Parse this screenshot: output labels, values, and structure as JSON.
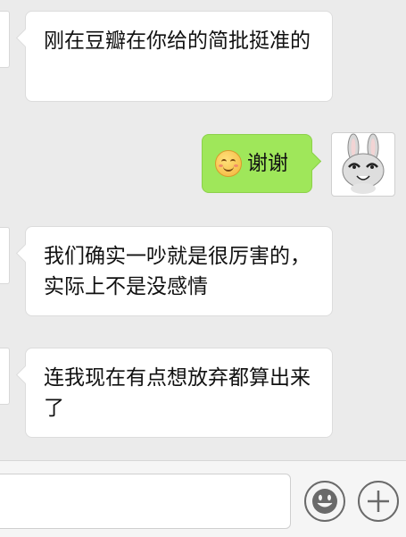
{
  "chat": {
    "messages": [
      {
        "side": "left",
        "text": "刚在豆瓣在你给的简批挺准的"
      },
      {
        "side": "right",
        "text": "谢谢",
        "emoji": "smiling-face-icon"
      },
      {
        "side": "left",
        "text": "我们确实一吵就是很厉害的，实际上不是没感情"
      },
      {
        "side": "left",
        "text": "连我现在有点想放弃都算出来了"
      }
    ]
  },
  "input_bar": {
    "text_value": "",
    "emoji_button": "smiley-face-icon",
    "more_button": "plus-icon"
  },
  "colors": {
    "background": "#ebebeb",
    "left_bubble": "#ffffff",
    "right_bubble": "#9fe75a"
  }
}
